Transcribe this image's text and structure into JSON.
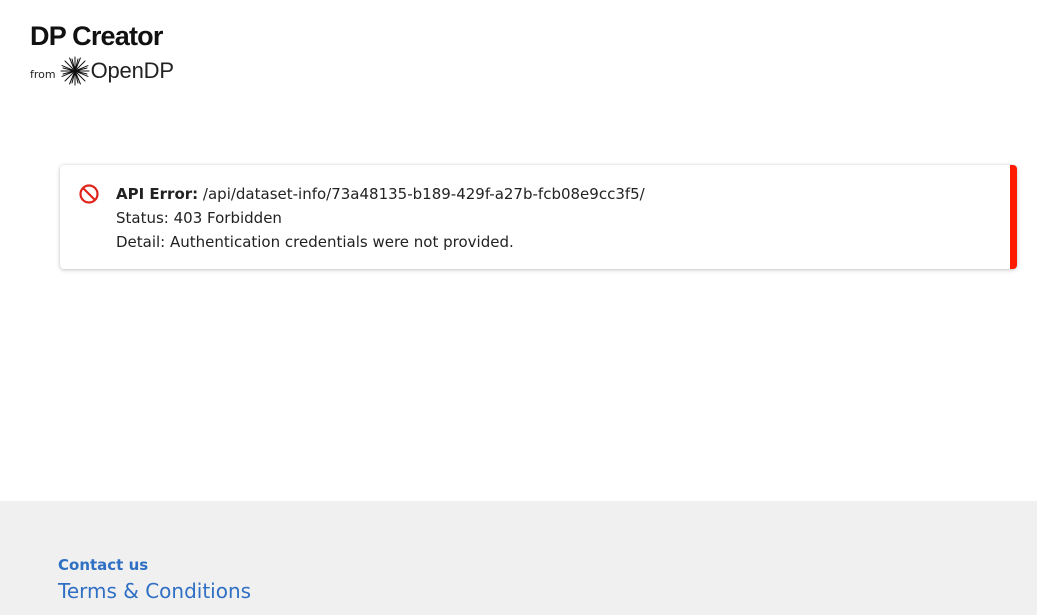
{
  "header": {
    "logo_title": "DP Creator",
    "logo_from": "from",
    "logo_org": "OpenDP",
    "logo_icon": "burst-icon"
  },
  "alert": {
    "icon": "blocked-icon",
    "error_label": "API Error:",
    "error_path": " /api/dataset-info/73a48135-b189-429f-a27b-fcb08e9cc3f5/",
    "status_line": "Status: 403 Forbidden",
    "detail_line": "Detail: Authentication credentials were not provided.",
    "accent_color": "#ff1a00"
  },
  "footer": {
    "contact_label": "Contact us",
    "terms_label": "Terms & Conditions",
    "link_color": "#2f6fc4"
  }
}
